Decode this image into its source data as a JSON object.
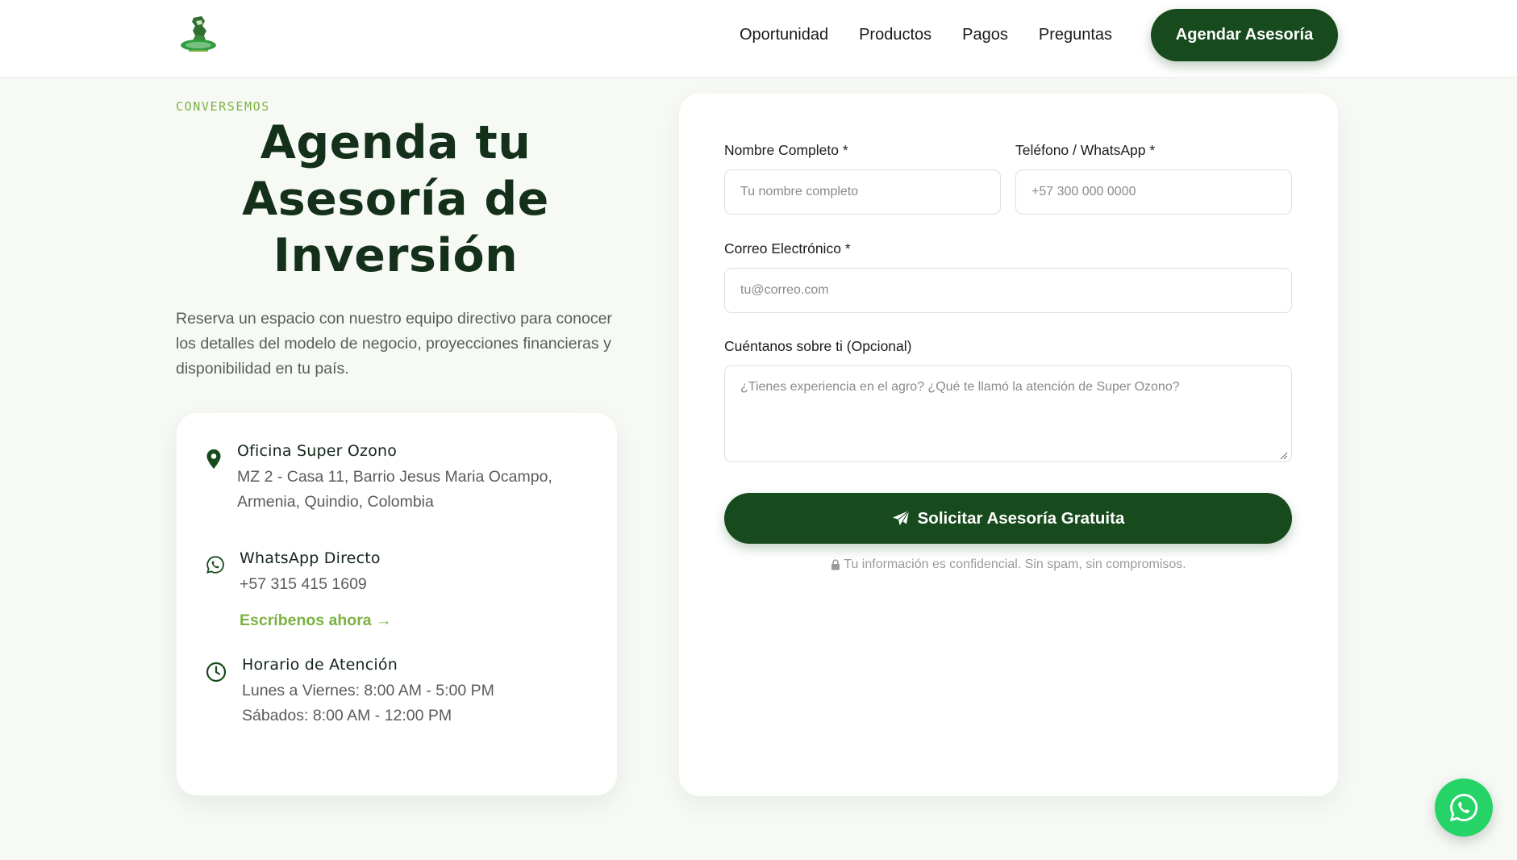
{
  "colors": {
    "brand_dark_green": "#174a1c",
    "accent_light_green": "#7bb241",
    "page_background": "#f6f9f4",
    "whatsapp_green": "#25d366"
  },
  "header": {
    "logo_icon": "super-ozono-logo",
    "nav": [
      {
        "label": "Oportunidad"
      },
      {
        "label": "Productos"
      },
      {
        "label": "Pagos"
      },
      {
        "label": "Preguntas"
      }
    ],
    "cta_label": "Agendar Asesoría"
  },
  "hero": {
    "eyebrow": "CONVERSEMOS",
    "title_line1": "Agenda tu",
    "title_line2": "Asesoría de",
    "title_line3": "Inversión",
    "description": "Reserva un espacio con nuestro equipo directivo para conocer los detalles del modelo de negocio, proyecciones financieras y disponibilidad en tu país."
  },
  "contact": {
    "office": {
      "icon": "map-pin-icon",
      "title": "Oficina Super Ozono",
      "address_line1": "MZ 2 - Casa 11, Barrio Jesus Maria Ocampo,",
      "address_line2": "Armenia, Quindio, Colombia"
    },
    "whatsapp": {
      "icon": "whatsapp-icon",
      "title": "WhatsApp Directo",
      "phone": "+57 315 415 1609",
      "link_label": "Escríbenos ahora →"
    },
    "hours": {
      "icon": "clock-icon",
      "title": "Horario de Atención",
      "weekdays": "Lunes a Viernes: 8:00 AM - 5:00 PM",
      "saturday": "Sábados: 8:00 AM - 12:00 PM"
    }
  },
  "form": {
    "name_label": "Nombre Completo *",
    "name_placeholder": "Tu nombre completo",
    "phone_label": "Teléfono / WhatsApp *",
    "phone_placeholder": "+57 300 000 0000",
    "email_label": "Correo Electrónico *",
    "email_placeholder": "tu@correo.com",
    "about_label": "Cuéntanos sobre ti (Opcional)",
    "about_placeholder": "¿Tienes experiencia en el agro? ¿Qué te llamó la atención de Super Ozono?",
    "submit_label": "Solicitar Asesoría Gratuita",
    "privacy_note": "Tu información es confidencial. Sin spam, sin compromisos."
  }
}
